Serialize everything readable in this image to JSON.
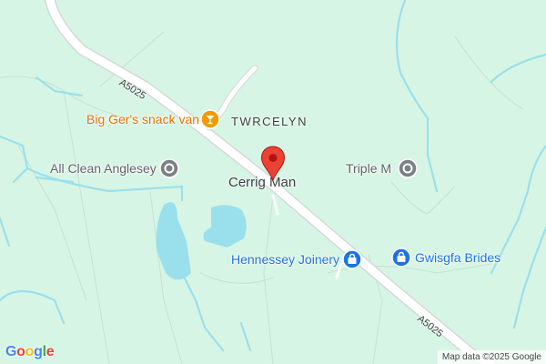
{
  "map": {
    "background_color": "#d7f5e4",
    "water_color": "#9ae0ec",
    "road_color": "#ffffff",
    "road_casing_color": "#d5d8dc",
    "marker_color": "#ea4335"
  },
  "places": {
    "town": "Cerrig Man",
    "area": "TWRCELYN"
  },
  "roads": [
    {
      "name": "A5025"
    },
    {
      "name": "A5025"
    }
  ],
  "pois": [
    {
      "name": "Big Ger's snack van",
      "category": "food",
      "icon": "cocktail-icon",
      "color": "#e37400",
      "icon_color": "#f29900"
    },
    {
      "name": "All Clean Anglesey",
      "category": "place",
      "icon": "generic-poi-icon",
      "color": "#5f6368",
      "icon_color": "#7b8084"
    },
    {
      "name": "Triple M",
      "category": "place",
      "icon": "generic-poi-icon",
      "color": "#5f6368",
      "icon_color": "#7b8084"
    },
    {
      "name": "Hennessey Joinery",
      "category": "shopping",
      "icon": "shopping-bag-icon",
      "color": "#1a73e8",
      "icon_color": "#1a73e8"
    },
    {
      "name": "Gwisgfa Brides",
      "category": "shopping",
      "icon": "shopping-bag-icon",
      "color": "#1a73e8",
      "icon_color": "#1a73e8"
    }
  ],
  "branding": {
    "logo_letters": [
      "G",
      "o",
      "o",
      "g",
      "l",
      "e"
    ],
    "logo_colors": [
      "#4285f4",
      "#ea4335",
      "#fbbc05",
      "#4285f4",
      "#34a853",
      "#ea4335"
    ]
  },
  "attribution": "Map data ©2025 Google"
}
